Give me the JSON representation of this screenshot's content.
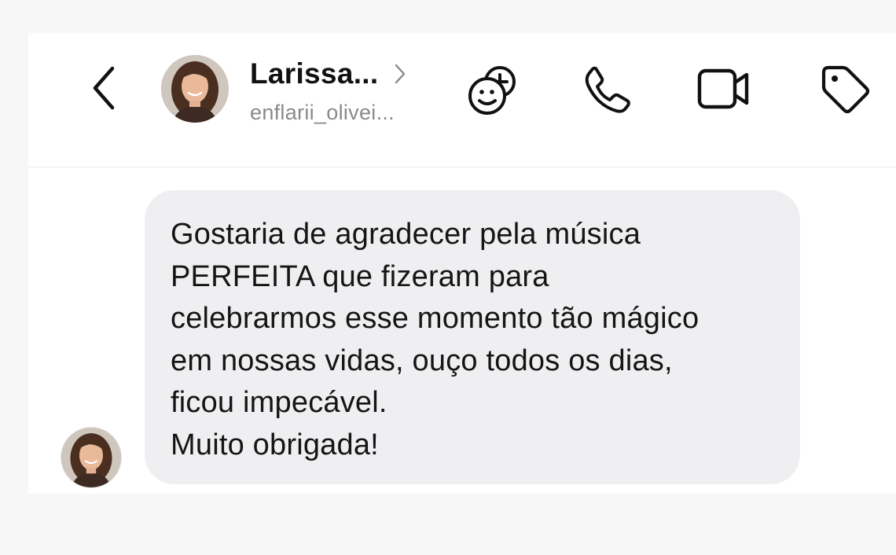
{
  "header": {
    "contact_name": "Larissa...",
    "username": "enflarii_olivei..."
  },
  "icons": {
    "back": "chevron-left-icon",
    "profile_chevron": "chevron-right-icon",
    "effects": "sticker-add-icon",
    "call": "phone-icon",
    "video": "video-camera-icon",
    "tag": "tag-icon"
  },
  "message": {
    "lines": [
      "Gostaria de agradecer pela música",
      "PERFEITA que fizeram para",
      "celebrarmos esse momento tão mágico",
      "em nossas vidas, ouço todos os dias,",
      "ficou impecável.",
      "Muito obrigada!"
    ]
  },
  "colors": {
    "background": "#f7f7f8",
    "card": "#ffffff",
    "bubble": "#efeff1",
    "text": "#151515",
    "muted": "#8a8a8a"
  }
}
